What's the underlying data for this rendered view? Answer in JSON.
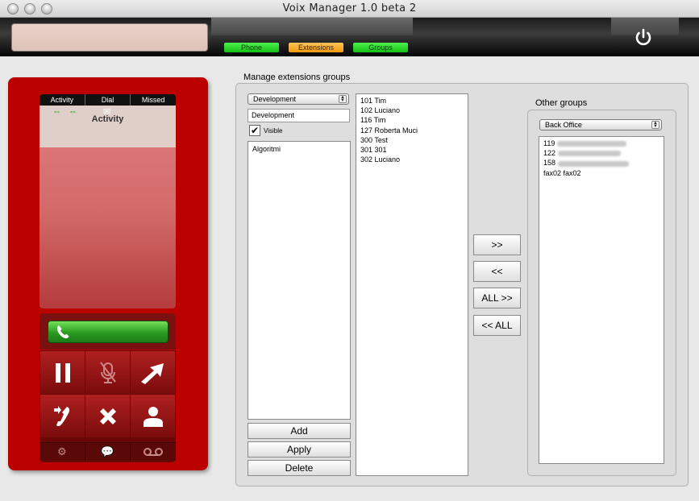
{
  "window": {
    "title": "Voix Manager 1.0 beta 2"
  },
  "toolbar": {
    "tabs": [
      {
        "label": "Phone",
        "color": "#22cc22"
      },
      {
        "label": "Extensions",
        "color": "#f5a623"
      },
      {
        "label": "Groups",
        "color": "#22cc22"
      }
    ]
  },
  "phone_panel": {
    "tabs": [
      "Activity",
      "Dial",
      "Missed"
    ],
    "activity_title": "Activity"
  },
  "manage": {
    "heading": "Manage extensions groups",
    "group_select": "Development",
    "group_name_value": "Development",
    "visible_label": "Visible",
    "visible_checked": true,
    "subgroups": [
      "Algoritmi"
    ],
    "members": [
      "101 Tim",
      "102 Luciano",
      "116 Tim",
      "127 Roberta Muci",
      "300 Test",
      "301 301",
      "302 Luciano"
    ],
    "buttons": {
      "add": "Add",
      "apply": "Apply",
      "delete": "Delete"
    },
    "move_buttons": {
      "add_selected": ">>",
      "remove_selected": "<<",
      "add_all": "ALL >>",
      "remove_all": "<< ALL"
    }
  },
  "other_groups": {
    "heading": "Other groups",
    "select": "Back Office",
    "items": [
      {
        "number": "119",
        "name_redacted": true
      },
      {
        "number": "122",
        "name_redacted": true
      },
      {
        "number": "158",
        "name_redacted": true
      },
      {
        "number": "fax02 fax02",
        "name_redacted": false
      }
    ]
  }
}
